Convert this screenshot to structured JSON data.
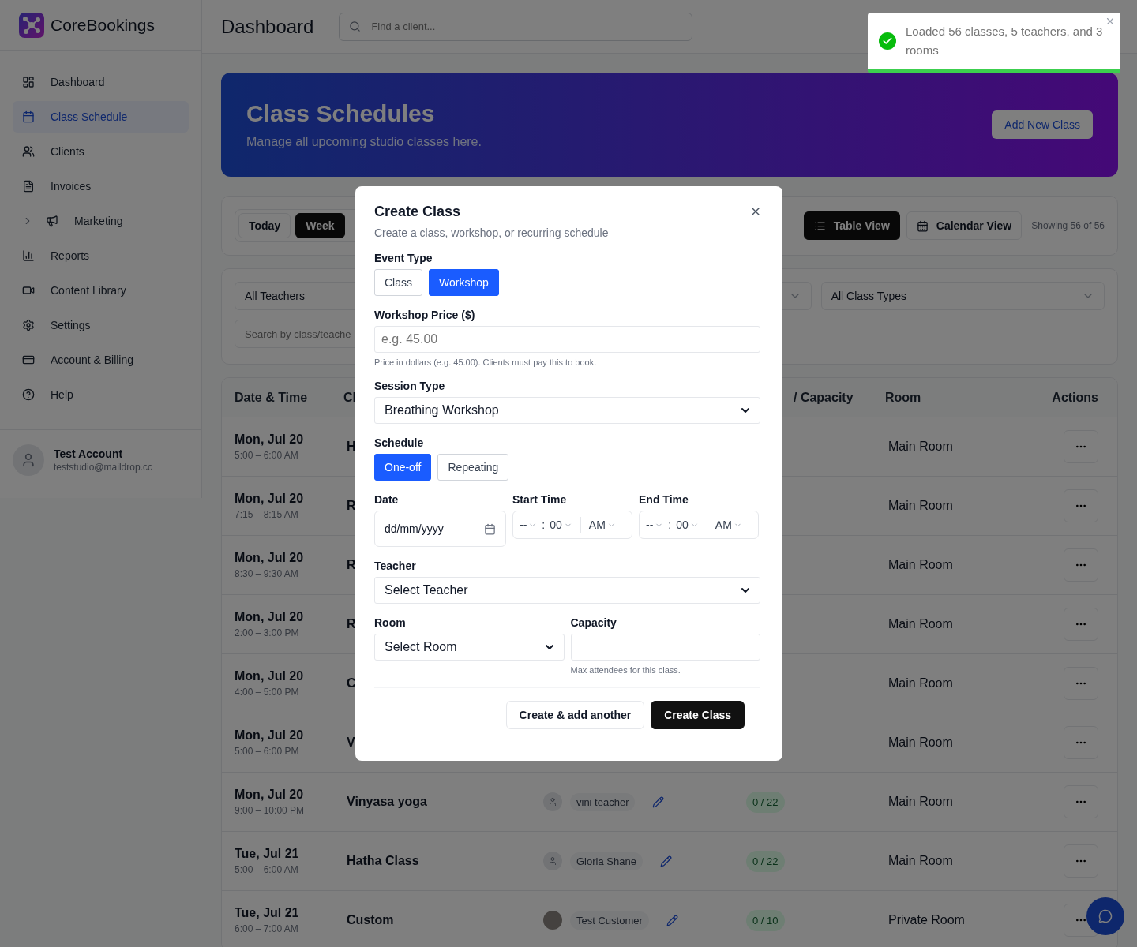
{
  "sidebar": {
    "brand": "CoreBookings",
    "items": [
      {
        "label": "Dashboard",
        "selected": false
      },
      {
        "label": "Class Schedule",
        "selected": true
      },
      {
        "label": "Clients",
        "selected": false
      },
      {
        "label": "Invoices",
        "selected": false
      },
      {
        "label": "Marketing",
        "selected": false,
        "expanded": false
      },
      {
        "label": "Reports",
        "selected": false
      },
      {
        "label": "Content Library",
        "selected": false
      },
      {
        "label": "Settings",
        "selected": false
      },
      {
        "label": "Account & Billing",
        "selected": false
      },
      {
        "label": "Help",
        "selected": false
      }
    ],
    "user": {
      "name": "Test Account",
      "email": "teststudio@maildrop.cc"
    }
  },
  "header": {
    "title": "Dashboard",
    "search": {
      "placeholder": "Find a client..."
    }
  },
  "toast": {
    "message": "Loaded 56 classes, 5 teachers, and 3 rooms"
  },
  "banner": {
    "title": "Class Schedules",
    "subtitle": "Manage all upcoming studio classes here.",
    "button": "Add New Class"
  },
  "toolbar": {
    "ranges": [
      {
        "label": "Today",
        "selected": false
      },
      {
        "label": "Week",
        "selected": true
      }
    ],
    "views": [
      {
        "label": "Table View",
        "selected": true
      },
      {
        "label": "Calendar View",
        "selected": false
      }
    ],
    "count": "Showing 56 of 56"
  },
  "filters": {
    "teacher": "All Teachers",
    "class_type": "All Class Types",
    "search": {
      "placeholder": "Search by class/teache"
    }
  },
  "table": {
    "columns": {
      "date": "Date & Time",
      "class": "Cl",
      "capacity": "/ Capacity",
      "room": "Room",
      "actions": "Actions"
    },
    "rows": [
      {
        "date": "Mon, Jul 20",
        "time": "5:00 – 6:00 AM",
        "class": "H",
        "room": "Main Room"
      },
      {
        "date": "Mon, Jul 20",
        "time": "7:15 – 8:15 AM",
        "class": "R",
        "room": "Main Room"
      },
      {
        "date": "Mon, Jul 20",
        "time": "8:30 – 9:30 AM",
        "class": "R",
        "room": "Main Room"
      },
      {
        "date": "Mon, Jul 20",
        "time": "2:00 – 3:00 PM",
        "class": "R",
        "room": "Main Room"
      },
      {
        "date": "Mon, Jul 20",
        "time": "4:00 – 5:00 PM",
        "class": "C",
        "room": "Main Room"
      },
      {
        "date": "Mon, Jul 20",
        "time": "5:00 – 6:00 PM",
        "class": "V",
        "room": "Main Room"
      },
      {
        "date": "Mon, Jul 20",
        "time": "9:00 – 10:00 PM",
        "class": "Vinyasa yoga",
        "teacher": {
          "name": "vini teacher",
          "photo": false
        },
        "enrolled": "0 / 22",
        "room": "Main Room"
      },
      {
        "date": "Tue, Jul 21",
        "time": "5:00 – 6:00 AM",
        "class": "Hatha Class",
        "teacher": {
          "name": "Gloria Shane",
          "photo": false
        },
        "enrolled": "0 / 22",
        "room": "Main Room"
      },
      {
        "date": "Tue, Jul 21",
        "time": "6:00 – 7:00 AM",
        "class": "Custom",
        "teacher": {
          "name": "Test Customer",
          "photo": true
        },
        "enrolled": "0 / 10",
        "room": "Private Room"
      }
    ]
  },
  "modal": {
    "title": "Create Class",
    "subtitle": "Create a class, workshop, or recurring schedule",
    "event_type": {
      "label": "Event Type",
      "options": [
        {
          "label": "Class",
          "selected": false
        },
        {
          "label": "Workshop",
          "selected": true
        }
      ]
    },
    "price": {
      "label": "Workshop Price ($)",
      "placeholder": "e.g. 45.00",
      "hint": "Price in dollars (e.g. 45.00). Clients must pay this to book."
    },
    "session_type": {
      "label": "Session Type",
      "value": "Breathing Workshop"
    },
    "schedule": {
      "label": "Schedule",
      "options": [
        {
          "label": "One-off",
          "selected": true
        },
        {
          "label": "Repeating",
          "selected": false
        }
      ]
    },
    "date": {
      "label": "Date",
      "placeholder": "dd/mm/yyyy"
    },
    "start_time": {
      "label": "Start Time",
      "hour": "--",
      "separator": ":",
      "minute": "00",
      "period": "AM"
    },
    "end_time": {
      "label": "End Time",
      "hour": "--",
      "separator": ":",
      "minute": "00",
      "period": "AM"
    },
    "teacher": {
      "label": "Teacher",
      "value": "Select Teacher"
    },
    "room": {
      "label": "Room",
      "value": "Select Room"
    },
    "capacity": {
      "label": "Capacity",
      "hint": "Max attendees for this class."
    },
    "buttons": [
      {
        "label": "Create & add another",
        "kind": "secondary"
      },
      {
        "label": "Create Class",
        "kind": "primary"
      }
    ]
  }
}
